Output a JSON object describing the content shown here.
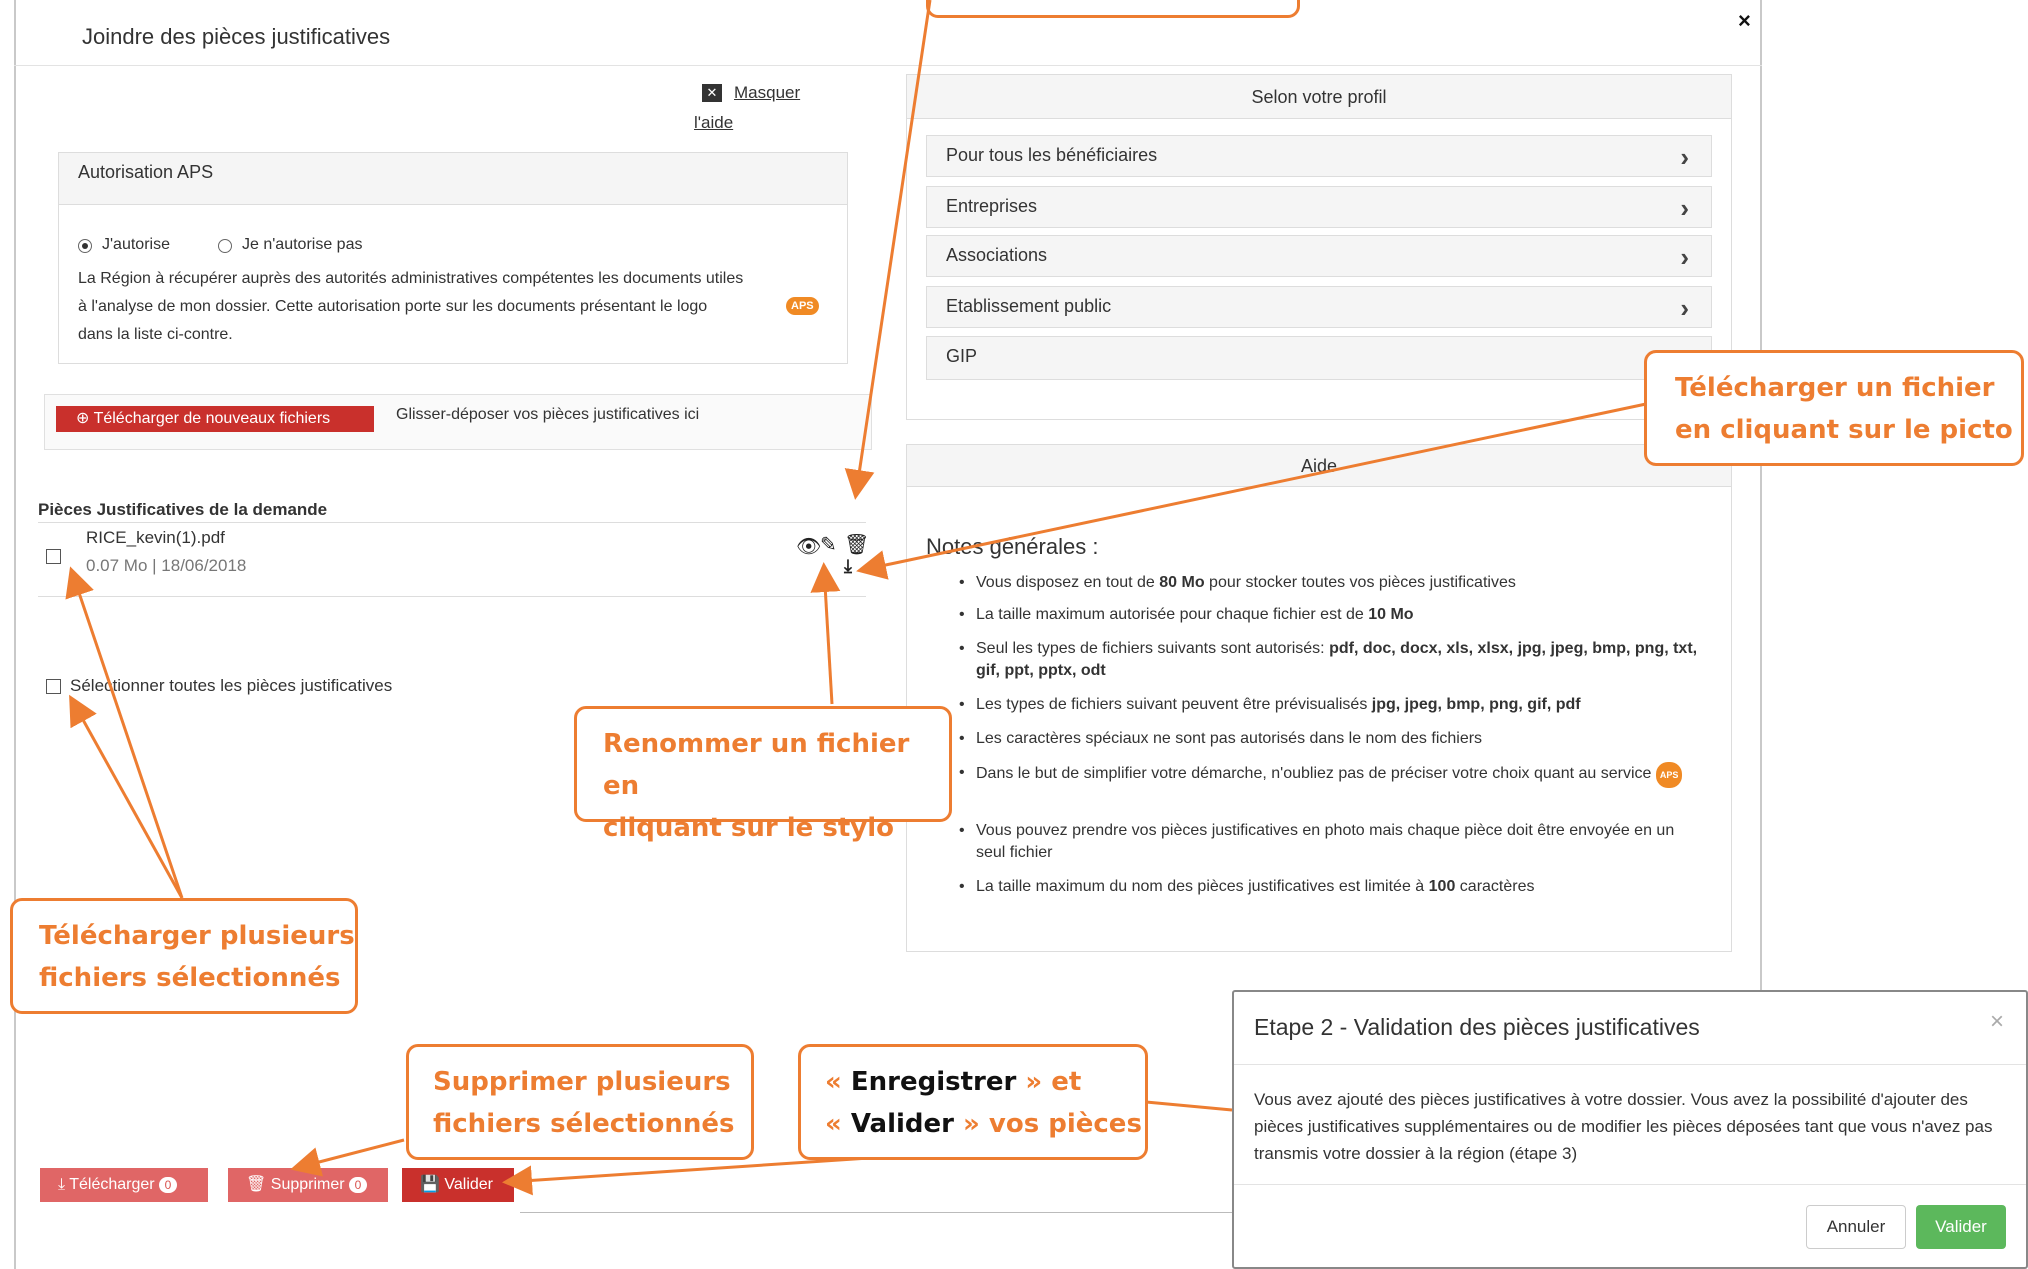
{
  "modal": {
    "title": "Joindre des pièces justificatives",
    "close": "×",
    "hide_help_line1": "Masquer",
    "hide_help_line2": "l'aide"
  },
  "aps": {
    "title": "Autorisation APS",
    "option_yes": "J'autorise",
    "option_no": "Je n'autorise pas",
    "selected": "J'autorise",
    "text_line1": "La Région à récupérer auprès des autorités administratives compétentes les documents utiles",
    "text_line2": "à l'analyse de mon dossier. Cette autorisation porte sur les documents présentant le logo",
    "text_line3": "dans la liste ci-contre.",
    "badge": "APS"
  },
  "upload": {
    "button": "Télécharger de nouveaux fichiers",
    "dropzone": "Glisser-déposer vos pièces justificatives ici"
  },
  "files": {
    "section_title": "Pièces Justificatives de la demande",
    "items": [
      {
        "name": "RICE_kevin(1).pdf",
        "meta": "0.07 Mo | 18/06/2018"
      }
    ],
    "select_all": "Sélectionner toutes les pièces justificatives"
  },
  "profile": {
    "title": "Selon votre profil",
    "items": [
      "Pour tous les bénéficiaires",
      "Entreprises",
      "Associations",
      "Etablissement public",
      "GIP"
    ]
  },
  "help": {
    "title": "Aide",
    "notes_title": "Notes générales :",
    "notes": [
      "Vous disposez en tout de 80 Mo pour stocker toutes vos pièces justificatives",
      "La taille maximum autorisée pour chaque fichier est de 10 Mo",
      "Seul les types de fichiers suivants sont autorisés: pdf, doc, docx, xls, xlsx, jpg, jpeg, bmp, png, txt, gif, ppt, pptx, odt",
      "Les types de fichiers suivant peuvent être prévisualisés jpg, jpeg, bmp, png, gif, pdf",
      "Les caractères spéciaux ne sont pas autorisés dans le nom des fichiers",
      "Dans le but de simplifier votre démarche, n'oubliez pas de préciser votre choix quant au service",
      "Vous pouvez prendre vos pièces justificatives en photo mais chaque pièce doit être envoyée en un seul fichier",
      "La taille maximum du nom des pièces justificatives est limitée à 100 caractères"
    ]
  },
  "actions": {
    "download": "Télécharger",
    "download_count": "0",
    "delete": "Supprimer",
    "delete_count": "0",
    "validate": "Valider"
  },
  "dialog": {
    "title": "Etape 2 - Validation des pièces justificatives",
    "close": "×",
    "body": "Vous avez ajouté des pièces justificatives à votre dossier. Vous avez la possibilité d'ajouter des pièces justificatives supplémentaires ou de modifier les pièces déposées tant que vous n'avez pas transmis votre dossier à la région (étape 3)",
    "cancel": "Annuler",
    "confirm": "Valider"
  },
  "callouts": {
    "download_file_l1": "Télécharger un fichier",
    "download_file_l2": "en cliquant sur le picto",
    "rename_l1": "Renommer un fichier en",
    "rename_l2": "cliquant sur le stylo",
    "multi_download_l1": "Télécharger plusieurs",
    "multi_download_l2": "fichiers sélectionnés",
    "multi_delete_l1": "Supprimer plusieurs",
    "multi_delete_l2": "fichiers sélectionnés",
    "save_validate_q1": "« ",
    "save_validate_word1": "Enregistrer",
    "save_validate_q2": " » et",
    "save_validate_q3": "« ",
    "save_validate_word2": "Valider",
    "save_validate_q4": " » vos pièces"
  },
  "colors": {
    "accent_orange": "#ed7d31",
    "danger": "#c9302c",
    "success": "#5cb85c"
  }
}
